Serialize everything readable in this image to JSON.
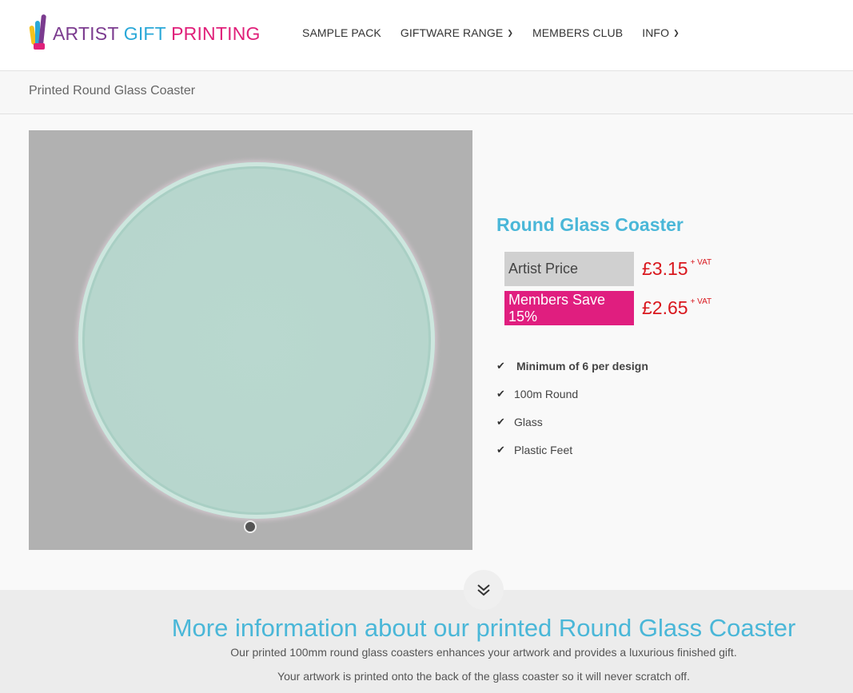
{
  "header": {
    "logo": {
      "word1": "ARTIST",
      "word2": "GIFT",
      "word3": "PRINTING"
    },
    "nav": [
      {
        "label": "SAMPLE PACK",
        "has_dropdown": false
      },
      {
        "label": "GIFTWARE RANGE",
        "has_dropdown": true
      },
      {
        "label": "MEMBERS CLUB",
        "has_dropdown": false
      },
      {
        "label": "INFO",
        "has_dropdown": true
      }
    ]
  },
  "breadcrumb": {
    "current": "Printed Round Glass Coaster"
  },
  "product": {
    "title": "Round Glass Coaster",
    "prices": [
      {
        "label": "Artist Price",
        "value": "£3.15",
        "suffix": "+ VAT"
      },
      {
        "label": "Members Save 15%",
        "value": "£2.65",
        "suffix": "+ VAT"
      }
    ],
    "features": [
      "Minimum of 6 per design",
      "100m Round",
      "Glass",
      "Plastic Feet"
    ]
  },
  "info": {
    "title": "More information about our printed Round Glass Coaster",
    "p1": "Our printed 100mm round glass coasters enhances your artwork and provides a luxurious finished gift.",
    "p2": "Your artwork is printed onto the back of the glass coaster so it will never scratch off."
  },
  "colors": {
    "accent_blue": "#4ab7d8",
    "member_pink": "#e01e7f",
    "price_red": "#d9171d"
  },
  "icons": {
    "check": "check-icon",
    "caret": "chevron-down-icon",
    "scroll": "double-chevron-down-icon"
  }
}
